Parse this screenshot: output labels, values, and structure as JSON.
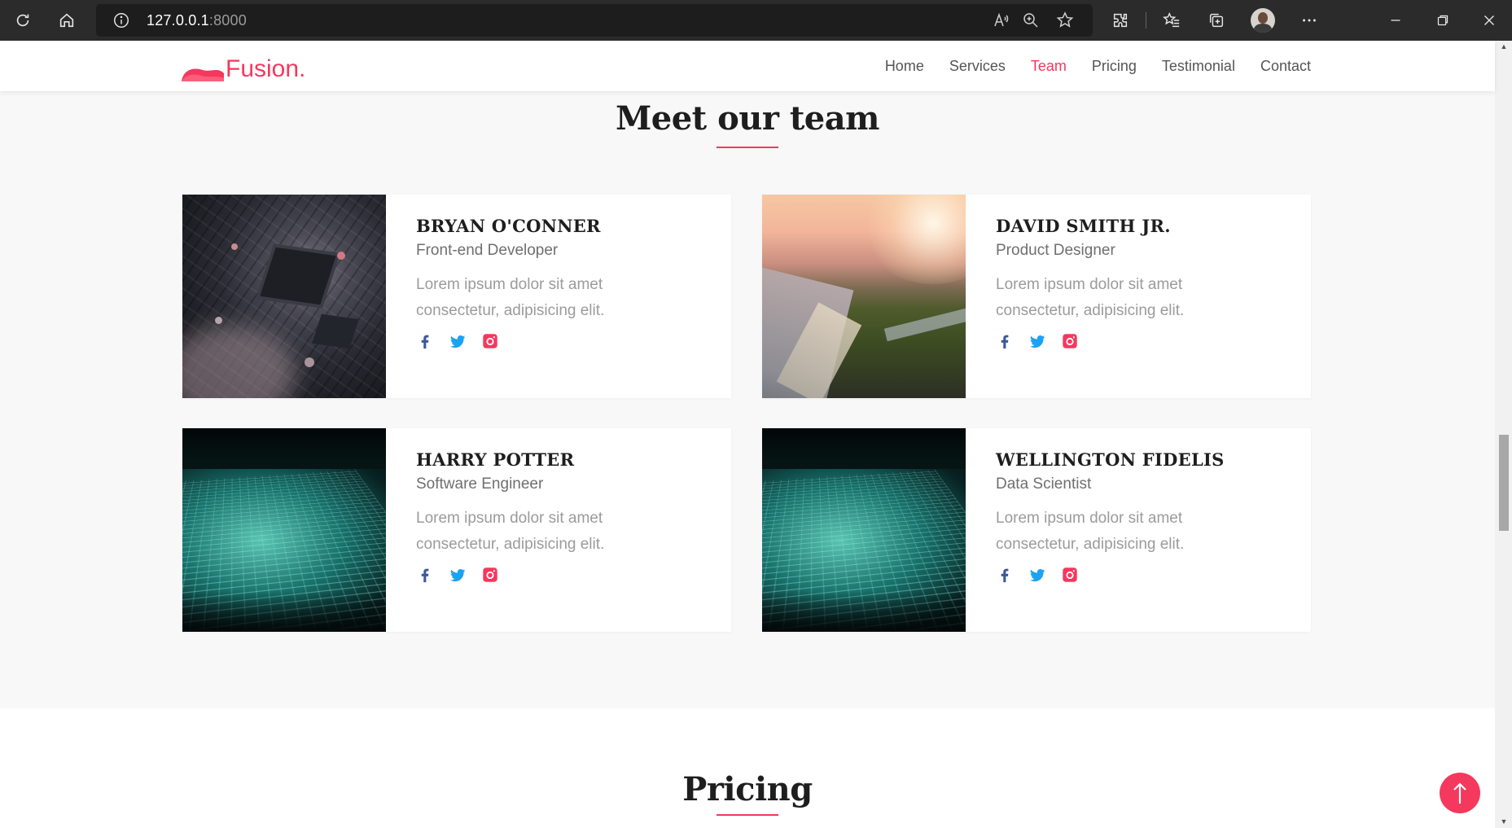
{
  "browser": {
    "url_host": "127.0.0.1",
    "url_port": ":8000"
  },
  "site": {
    "logo_text": "Fusion.",
    "brand_color": "#f5385d",
    "nav": [
      {
        "label": "Home",
        "active": false
      },
      {
        "label": "Services",
        "active": false
      },
      {
        "label": "Team",
        "active": true
      },
      {
        "label": "Pricing",
        "active": false
      },
      {
        "label": "Testimonial",
        "active": false
      },
      {
        "label": "Contact",
        "active": false
      }
    ]
  },
  "team": {
    "title": "Meet our team",
    "members": [
      {
        "name": "BRYAN O'CONNER",
        "role": "Front-end Developer",
        "description": "Lorem ipsum dolor sit amet consectetur, adipisicing elit.",
        "photo": "circuit-board-chip-photo"
      },
      {
        "name": "DAVID SMITH JR.",
        "role": "Product Designer",
        "description": "Lorem ipsum dolor sit amet consectetur, adipisicing elit.",
        "photo": "coastline-aerial-photo"
      },
      {
        "name": "HARRY POTTER",
        "role": "Software Engineer",
        "description": "Lorem ipsum dolor sit amet consectetur, adipisicing elit.",
        "photo": "glowing-circuit-photo"
      },
      {
        "name": "WELLINGTON FIDELIS",
        "role": "Data Scientist",
        "description": "Lorem ipsum dolor sit amet consectetur, adipisicing elit.",
        "photo": "glowing-circuit-photo"
      }
    ],
    "social_icons": [
      "facebook-icon",
      "twitter-icon",
      "instagram-icon"
    ],
    "social_colors": {
      "facebook": "#3b5998",
      "twitter": "#1da1f2",
      "instagram": "#f5385d"
    }
  },
  "pricing": {
    "title": "Pricing"
  }
}
